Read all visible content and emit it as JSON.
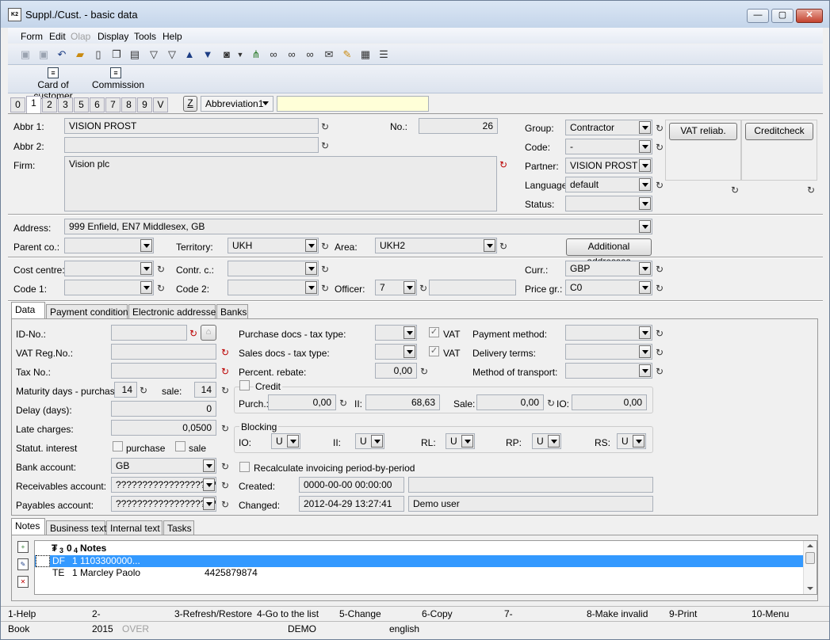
{
  "window": {
    "title": "Suppl./Cust. - basic data",
    "app_icon_text": "K2",
    "minimize_glyph": "—",
    "maximize_glyph": "▢",
    "close_glyph": "✕"
  },
  "menu": [
    "Form",
    "Edit",
    "Olap",
    "Display",
    "Tools",
    "Help"
  ],
  "menu_disabled": [
    "Olap"
  ],
  "toolbar_icons": [
    "save-icon",
    "save-as-icon",
    "undo-icon",
    "open-folder-icon",
    "new-document-icon",
    "copy-document-icon",
    "book-icon",
    "filter-icon",
    "filter-edit-icon",
    "arrow-up-icon",
    "arrow-down-icon",
    "camera-icon",
    "dropdown-arrow-icon",
    "tree-icon",
    "binoculars-icon",
    "find-next-icon",
    "find-replace-icon",
    "mail-icon",
    "edit-document-icon",
    "print-preview-icon",
    "menu-lines-icon"
  ],
  "toolbar2": {
    "card_of_customer": "Card of customer",
    "commission": "Commission"
  },
  "tabs": {
    "numbers": [
      "0",
      "1",
      "2",
      "3",
      "5",
      "6",
      "7",
      "8",
      "9",
      "V"
    ],
    "active": "1",
    "z_button": "Z",
    "selector": "Abbreviation1",
    "search_value": ""
  },
  "basic": {
    "abbr1_label": "Abbr 1:",
    "abbr1": "VISION PROST",
    "abbr2_label": "Abbr 2:",
    "abbr2": "",
    "firm_label": "Firm:",
    "firm": "Vision plc",
    "no_label": "No.:",
    "no": "26",
    "group_label": "Group:",
    "group": "Contractor",
    "code_label": "Code:",
    "code": "-",
    "partner_label": "Partner:",
    "partner": "VISION PROST",
    "language_label": "Language:",
    "language": "default",
    "status_label": "Status:",
    "status": "",
    "vat_reliab": "VAT reliab.",
    "creditcheck": "Creditcheck"
  },
  "address": {
    "address_label": "Address:",
    "address": "999  Enfield, EN7  Middlesex, GB",
    "parent_label": "Parent co.:",
    "parent": "",
    "territory_label": "Territory:",
    "territory": "UKH",
    "area_label": "Area:",
    "area": "UKH2",
    "additional_addresses": "Additional addresses"
  },
  "costs": {
    "cost_centre_label": "Cost centre:",
    "cost_centre": "",
    "contr_label": "Contr. c.:",
    "contr": "",
    "curr_label": "Curr.:",
    "curr": "GBP",
    "code1_label": "Code 1:",
    "code1": "",
    "code2_label": "Code 2:",
    "code2": "",
    "officer_label": "Officer:",
    "officer": "7",
    "officer_name": "",
    "price_gr_label": "Price gr.:",
    "price_gr": "C0"
  },
  "subtabs": [
    "Data",
    "Payment conditions",
    "Electronic addresses",
    "Banks"
  ],
  "data": {
    "id_no_label": "ID-No.:",
    "id_no": "",
    "vat_reg_label": "VAT Reg.No.:",
    "vat_reg": "",
    "tax_no_label": "Tax No.:",
    "tax_no": "",
    "maturity_label": "Maturity days - purchase:",
    "maturity_purchase": "14",
    "sale_label": "sale:",
    "maturity_sale": "14",
    "delay_label": "Delay  (days):",
    "delay": "0",
    "late_charges_label": "Late charges:",
    "late_charges": "0,0500",
    "statut_interest_label": "Statut. interest",
    "purchase_chk_label": "purchase",
    "sale_chk_label": "sale",
    "bank_account_label": "Bank account:",
    "bank_account": "GB",
    "receivables_label": "Receivables account:",
    "receivables": "????????????????????",
    "payables_label": "Payables account:",
    "payables": "????????????????????",
    "purchase_tax_label": "Purchase docs - tax type:",
    "purchase_tax": "",
    "vat_label": "VAT",
    "vat_check_glyph": "✓",
    "sales_tax_label": "Sales docs - tax type:",
    "sales_tax": "",
    "rebate_label": "Percent. rebate:",
    "rebate": "0,00",
    "payment_method_label": "Payment method:",
    "payment_method": "",
    "delivery_terms_label": "Delivery terms:",
    "delivery_terms": "",
    "transport_label": "Method of transport:",
    "transport": "",
    "credit_label": "Credit",
    "purch_label": "Purch.:",
    "purch": "0,00",
    "ii_label": "II:",
    "ii": "68,63",
    "sale2_label": "Sale:",
    "sale2": "0,00",
    "io_label": "IO:",
    "io": "0,00",
    "blocking_label": "Blocking",
    "blocking": [
      {
        "label": "IO:",
        "value": "U"
      },
      {
        "label": "II:",
        "value": "U"
      },
      {
        "label": "RL:",
        "value": "U"
      },
      {
        "label": "RP:",
        "value": "U"
      },
      {
        "label": "RS:",
        "value": "U"
      }
    ],
    "recalc_label": "Recalculate invoicing period-by-period",
    "created_label": "Created:",
    "created": "0000-00-00 00:00:00",
    "created_by": "",
    "changed_label": "Changed:",
    "changed": "2012-04-29 13:27:41",
    "changed_by": "Demo user"
  },
  "notes_tabs": [
    "Notes",
    "Business text",
    "Internal text",
    "Tasks"
  ],
  "notes": {
    "header": {
      "c1": "₮",
      "c2": "3",
      "c3": "0",
      "c4": "4",
      "c5": "Notes"
    },
    "rows": [
      {
        "type": "DF",
        "num": "1",
        "text": "1103300000...",
        "extra": ""
      },
      {
        "type": "TE",
        "num": "1",
        "text": "Marcley Paolo",
        "extra": "4425879874"
      }
    ]
  },
  "fkeys": [
    "1-Help",
    "2-",
    "3-Refresh/Restore",
    "4-Go to the list",
    "5-Change",
    "6-Copy",
    "7-",
    "8-Make invalid",
    "9-Print",
    "10-Menu"
  ],
  "status": {
    "mode": "Book",
    "year": "2015",
    "over": "OVER",
    "db": "DEMO",
    "lang": "english"
  }
}
